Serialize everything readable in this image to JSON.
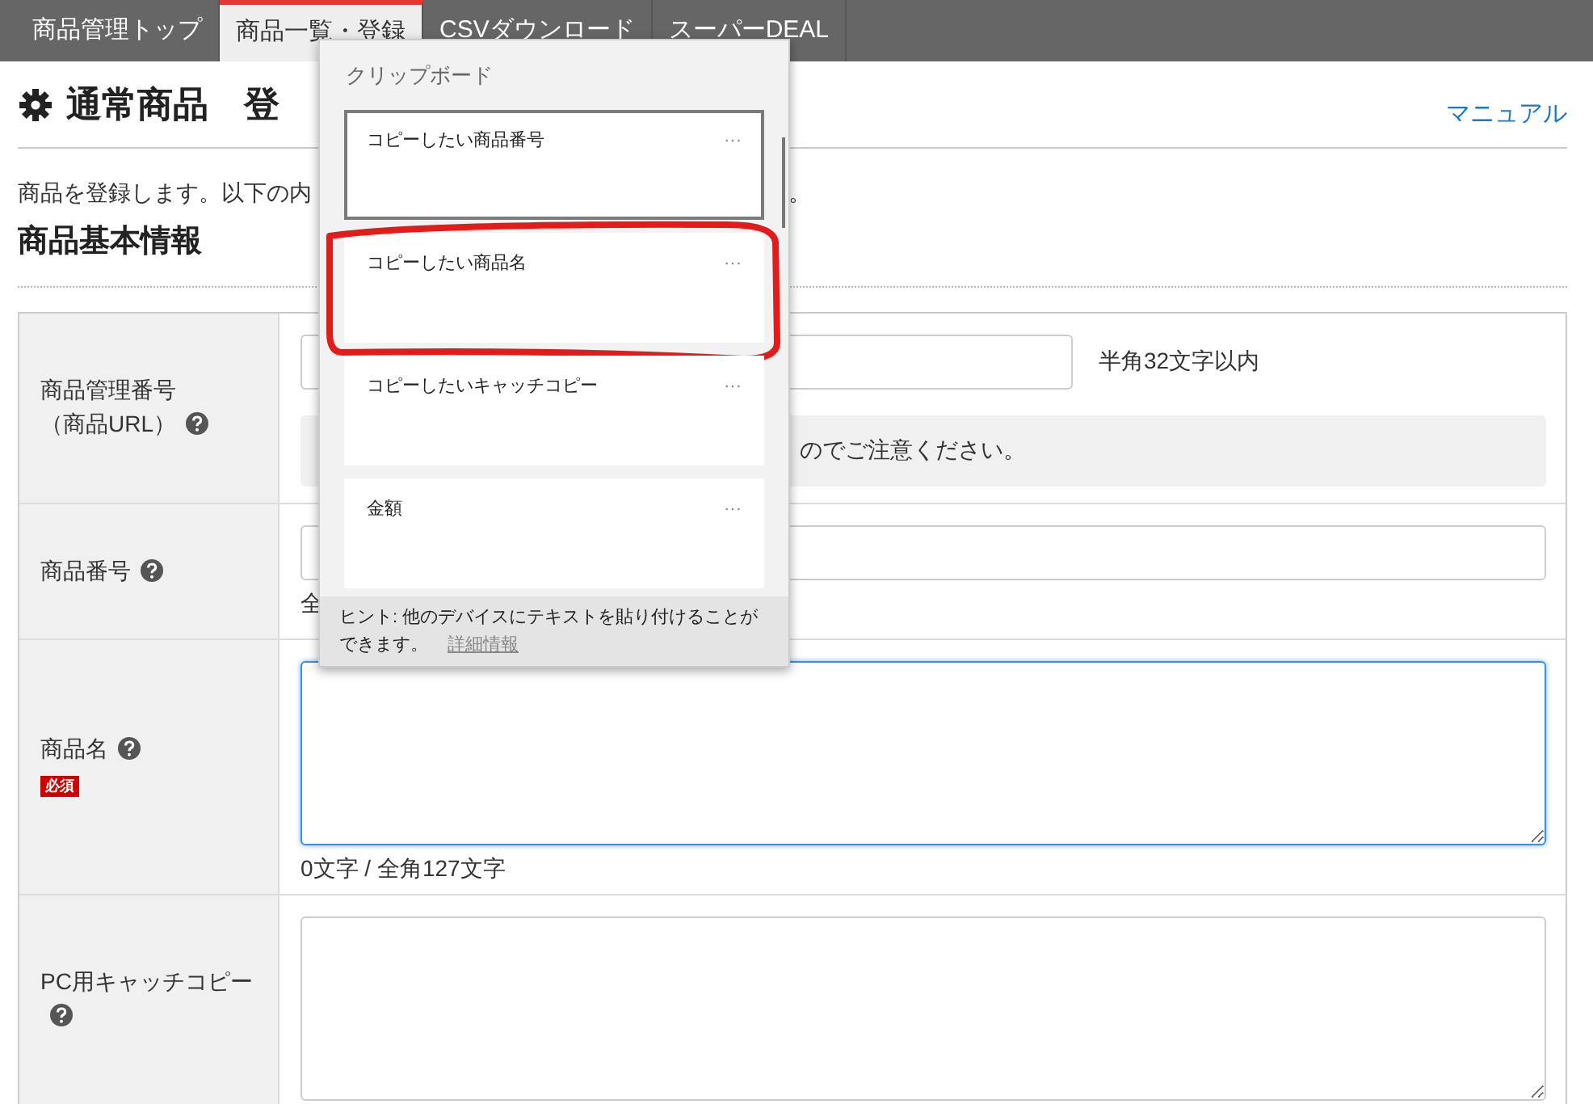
{
  "tabs": [
    {
      "label": "商品管理トップ",
      "selected": false
    },
    {
      "label": "商品一覧・登録",
      "selected": true
    },
    {
      "label": "CSVダウンロード",
      "selected": false
    },
    {
      "label": "スーパーDEAL",
      "selected": false
    }
  ],
  "page_title": "通常商品　登",
  "manual_link": "マニュアル",
  "description": {
    "text": "商品を登録します。以下の内",
    "tail": "。"
  },
  "section_title": "商品基本情報",
  "form_rows": [
    {
      "label_lines": [
        "商品管理番号",
        "（商品URL）"
      ],
      "help": true,
      "kind": "input",
      "focused": false,
      "hint": "半角32文字以内",
      "notice": "のでご注意ください。"
    },
    {
      "label_lines": [
        "商品番号"
      ],
      "help": true,
      "kind": "input",
      "focused": false,
      "note": "全"
    },
    {
      "label_lines": [
        "商品名"
      ],
      "help": true,
      "badge": "必須",
      "kind": "textarea",
      "focused": true,
      "note": "0文字 / 全角127文字"
    },
    {
      "label_lines": [
        "PC用キャッチコピー"
      ],
      "help": true,
      "kind": "textarea",
      "focused": false
    }
  ],
  "clipboard": {
    "title": "クリップボード",
    "items": [
      {
        "text": "コピーしたい商品番号",
        "selected": true,
        "highlighted": false
      },
      {
        "text": "コピーしたい商品名",
        "selected": false,
        "highlighted": true
      },
      {
        "text": "コピーしたいキャッチコピー",
        "selected": false,
        "highlighted": false
      },
      {
        "text": "金額",
        "selected": false,
        "highlighted": false
      }
    ],
    "more_icon": "···",
    "hint": "ヒント: 他のデバイスにテキストを貼り付けることができます。",
    "hint_link": "詳細情報"
  }
}
